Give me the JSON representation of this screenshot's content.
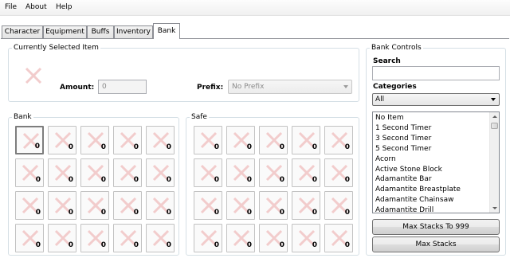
{
  "menu": {
    "items": [
      "File",
      "About",
      "Help"
    ]
  },
  "tabs": [
    {
      "label": "Character"
    },
    {
      "label": "Equipment"
    },
    {
      "label": "Buffs"
    },
    {
      "label": "Inventory"
    },
    {
      "label": "Bank",
      "active": true
    }
  ],
  "selected_item": {
    "title": "Currently Selected Item",
    "amount_label": "Amount:",
    "amount_value": "0",
    "prefix_label": "Prefix:",
    "prefix_value": "No Prefix"
  },
  "bank": {
    "title": "Bank",
    "slots": [
      "0",
      "0",
      "0",
      "0",
      "0",
      "0",
      "0",
      "0",
      "0",
      "0",
      "0",
      "0",
      "0",
      "0",
      "0",
      "0",
      "0",
      "0",
      "0",
      "0"
    ]
  },
  "safe": {
    "title": "Safe",
    "slots": [
      "0",
      "0",
      "0",
      "0",
      "0",
      "0",
      "0",
      "0",
      "0",
      "0",
      "0",
      "0",
      "0",
      "0",
      "0",
      "0",
      "0",
      "0",
      "0",
      "0"
    ]
  },
  "controls": {
    "title": "Bank Controls",
    "search_label": "Search",
    "search_value": "",
    "categories_label": "Categories",
    "category_selected": "All",
    "items": [
      "No Item",
      "1 Second Timer",
      "3 Second Timer",
      "5 Second Timer",
      "Acorn",
      "Active Stone Block",
      "Adamantite Bar",
      "Adamantite Breastplate",
      "Adamantite Chainsaw",
      "Adamantite Drill"
    ],
    "max_999_label": "Max Stacks To 999",
    "max_label": "Max Stacks"
  },
  "colors": {
    "empty_x": "#f2cccc",
    "group_border": "#d5dfe5"
  },
  "icons": {
    "empty_slot": "red-x-icon"
  }
}
